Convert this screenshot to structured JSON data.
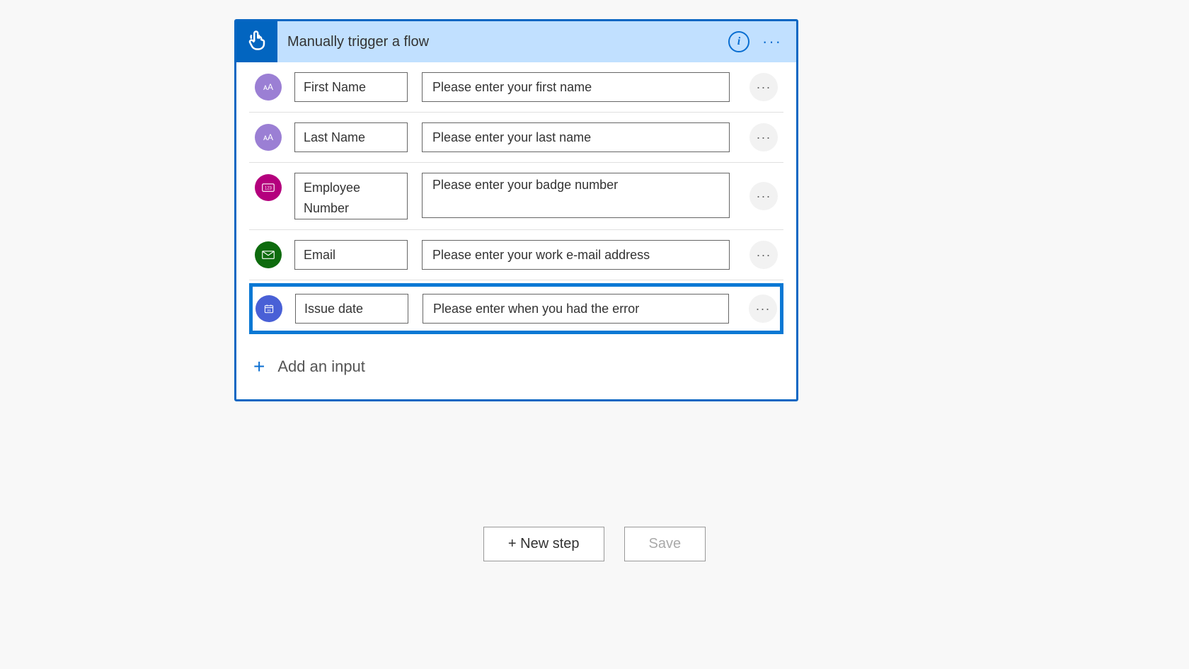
{
  "trigger": {
    "title": "Manually trigger a flow",
    "inputs": [
      {
        "type": "text",
        "name": "First Name",
        "description": "Please enter your first name"
      },
      {
        "type": "text",
        "name": "Last Name",
        "description": "Please enter your last name"
      },
      {
        "type": "number",
        "name": "Employee Number",
        "description": "Please enter your badge number"
      },
      {
        "type": "email",
        "name": "Email",
        "description": "Please enter your work e-mail address"
      },
      {
        "type": "date",
        "name": "Issue date",
        "description": "Please enter when you had the error",
        "selected": true
      }
    ],
    "addInputLabel": "Add an input"
  },
  "footer": {
    "newStep": "+ New step",
    "save": "Save"
  }
}
